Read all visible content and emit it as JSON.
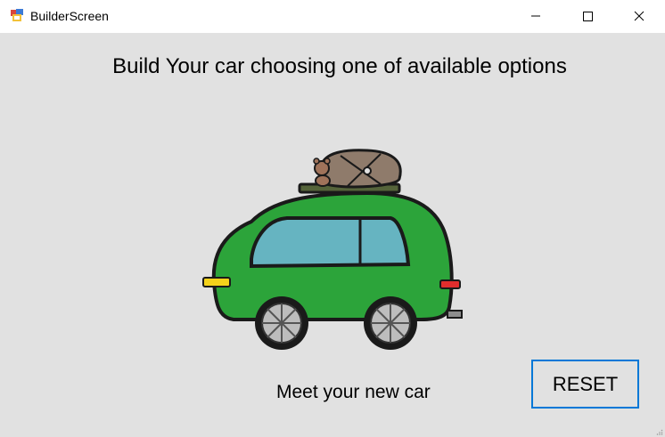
{
  "window": {
    "title": "BuilderScreen",
    "controls": [
      "minimize",
      "maximize",
      "close"
    ]
  },
  "main": {
    "heading": "Build Your car choosing one of available options",
    "image_subject": "green car with roof luggage and teddy bear",
    "caption": "Meet your new car",
    "reset_label": "RESET"
  },
  "colors": {
    "background": "#e1e1e1",
    "car_body": "#2ca43a",
    "window_glass": "#66b4c1",
    "button_border": "#0078d7"
  }
}
